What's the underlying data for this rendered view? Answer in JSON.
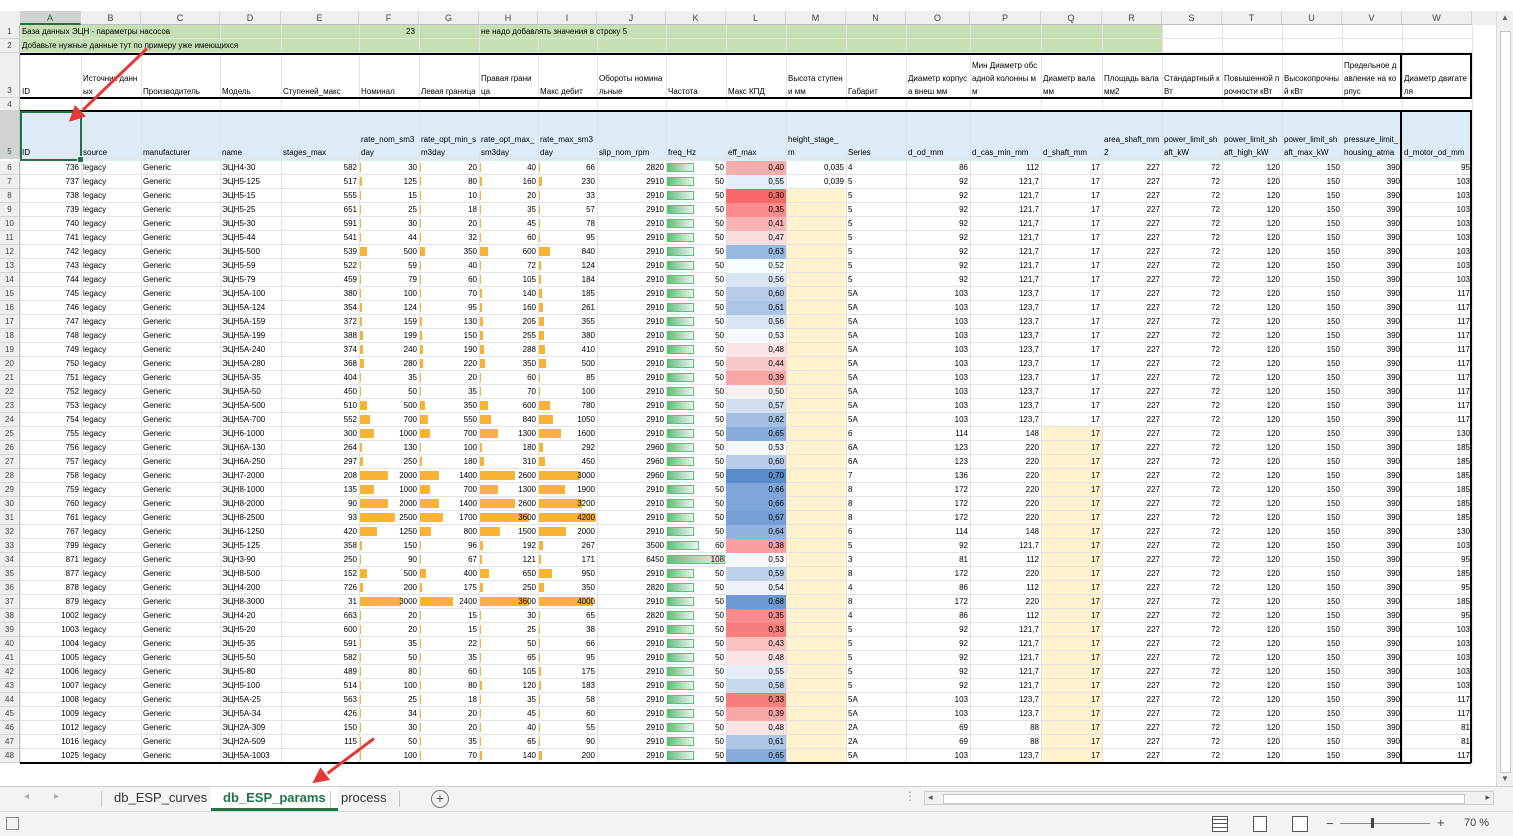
{
  "columns": [
    "A",
    "B",
    "C",
    "D",
    "E",
    "F",
    "G",
    "H",
    "I",
    "J",
    "K",
    "L",
    "M",
    "N",
    "O",
    "P",
    "Q",
    "R",
    "S",
    "T",
    "U",
    "V",
    "W"
  ],
  "row1": {
    "title": "База данных ЭЦН - параметры насосов",
    "value": "23",
    "note": "не надо добавлять значения в строку 5"
  },
  "row2": {
    "hint": "Добавьте нужные данные тут по примеру уже имеющихся"
  },
  "header_ru": [
    "ID",
    "Источник данных",
    "Производитель",
    "Модель",
    "Ступеней_макс",
    "Номинал",
    "Левая граница",
    "Правая граница",
    "Макс дебит",
    "Обороты номинальные",
    "Частота",
    "Макс КПД",
    "Высота ступени мм",
    "Габарит",
    "Диаметр корпуса внеш мм",
    "Мин Диаметр обсадной колонны мм",
    "Диаметр вала мм",
    "Площадь вала мм2",
    "Стандартный кВт",
    "Повышенной прочности кВт",
    "Высокопрочный кВт",
    "Предельное давление на корпус",
    "Диаметр двигателя"
  ],
  "header_en": [
    "ID",
    "source",
    "manufacturer",
    "name",
    "stages_max",
    "rate_nom_sm3day",
    "rate_opt_min_sm3day",
    "rate_opt_max_sm3day",
    "rate_max_sm3day",
    "slip_nom_rpm",
    "freq_Hz",
    "eff_max",
    "height_stage_m",
    "Series",
    "d_od_mm",
    "d_cas_min_mm",
    "d_shaft_mm",
    "area_shaft_mm2",
    "power_limit_shaft_kW",
    "power_limit_shaft_high_kW",
    "power_limit_shaft_max_kW",
    "pressure_limit_housing_atma",
    "d_motor_od_mm"
  ],
  "rows": [
    [
      "736",
      "legacy",
      "Generic",
      "ЭЦН4-30",
      "582",
      "30",
      "20",
      "40",
      "66",
      "2820",
      "50",
      "0,40",
      "0,035",
      "4",
      "86",
      "112",
      "17",
      "227",
      "72",
      "120",
      "150",
      "390",
      "95"
    ],
    [
      "737",
      "legacy",
      "Generic",
      "ЭЦН5-125",
      "517",
      "125",
      "80",
      "160",
      "230",
      "2910",
      "50",
      "0,55",
      "0,039",
      "5",
      "92",
      "121,7",
      "17",
      "227",
      "72",
      "120",
      "150",
      "390",
      "103"
    ],
    [
      "738",
      "legacy",
      "Generic",
      "ЭЦН5-15",
      "555",
      "15",
      "10",
      "20",
      "33",
      "2910",
      "50",
      "0,30",
      "",
      "5",
      "92",
      "121,7",
      "17",
      "227",
      "72",
      "120",
      "150",
      "390",
      "103"
    ],
    [
      "739",
      "legacy",
      "Generic",
      "ЭЦН5-25",
      "651",
      "25",
      "18",
      "35",
      "57",
      "2910",
      "50",
      "0,35",
      "",
      "5",
      "92",
      "121,7",
      "17",
      "227",
      "72",
      "120",
      "150",
      "390",
      "103"
    ],
    [
      "740",
      "legacy",
      "Generic",
      "ЭЦН5-30",
      "591",
      "30",
      "20",
      "45",
      "78",
      "2910",
      "50",
      "0,41",
      "",
      "5",
      "92",
      "121,7",
      "17",
      "227",
      "72",
      "120",
      "150",
      "390",
      "103"
    ],
    [
      "741",
      "legacy",
      "Generic",
      "ЭЦН5-44",
      "541",
      "44",
      "32",
      "60",
      "95",
      "2910",
      "50",
      "0,47",
      "",
      "5",
      "92",
      "121,7",
      "17",
      "227",
      "72",
      "120",
      "150",
      "390",
      "103"
    ],
    [
      "742",
      "legacy",
      "Generic",
      "ЭЦН5-500",
      "539",
      "500",
      "350",
      "600",
      "840",
      "2910",
      "50",
      "0,63",
      "",
      "5",
      "92",
      "121,7",
      "17",
      "227",
      "72",
      "120",
      "150",
      "390",
      "103"
    ],
    [
      "743",
      "legacy",
      "Generic",
      "ЭЦН5-59",
      "522",
      "59",
      "40",
      "72",
      "124",
      "2910",
      "50",
      "0,52",
      "",
      "5",
      "92",
      "121,7",
      "17",
      "227",
      "72",
      "120",
      "150",
      "390",
      "103"
    ],
    [
      "744",
      "legacy",
      "Generic",
      "ЭЦН5-79",
      "459",
      "79",
      "60",
      "105",
      "184",
      "2910",
      "50",
      "0,56",
      "",
      "5",
      "92",
      "121,7",
      "17",
      "227",
      "72",
      "120",
      "150",
      "390",
      "103"
    ],
    [
      "745",
      "legacy",
      "Generic",
      "ЭЦН5А-100",
      "380",
      "100",
      "70",
      "140",
      "185",
      "2910",
      "50",
      "0,60",
      "",
      "5A",
      "103",
      "123,7",
      "17",
      "227",
      "72",
      "120",
      "150",
      "390",
      "117"
    ],
    [
      "746",
      "legacy",
      "Generic",
      "ЭЦН5А-124",
      "354",
      "124",
      "95",
      "160",
      "261",
      "2910",
      "50",
      "0,61",
      "",
      "5A",
      "103",
      "123,7",
      "17",
      "227",
      "72",
      "120",
      "150",
      "390",
      "117"
    ],
    [
      "747",
      "legacy",
      "Generic",
      "ЭЦН5А-159",
      "372",
      "159",
      "130",
      "205",
      "355",
      "2910",
      "50",
      "0,56",
      "",
      "5A",
      "103",
      "123,7",
      "17",
      "227",
      "72",
      "120",
      "150",
      "390",
      "117"
    ],
    [
      "748",
      "legacy",
      "Generic",
      "ЭЦН5А-199",
      "388",
      "199",
      "150",
      "255",
      "380",
      "2910",
      "50",
      "0,53",
      "",
      "5A",
      "103",
      "123,7",
      "17",
      "227",
      "72",
      "120",
      "150",
      "390",
      "117"
    ],
    [
      "749",
      "legacy",
      "Generic",
      "ЭЦН5А-240",
      "374",
      "240",
      "190",
      "288",
      "410",
      "2910",
      "50",
      "0,48",
      "",
      "5A",
      "103",
      "123,7",
      "17",
      "227",
      "72",
      "120",
      "150",
      "390",
      "117"
    ],
    [
      "750",
      "legacy",
      "Generic",
      "ЭЦН5А-280",
      "368",
      "280",
      "220",
      "350",
      "500",
      "2910",
      "50",
      "0,44",
      "",
      "5A",
      "103",
      "123,7",
      "17",
      "227",
      "72",
      "120",
      "150",
      "390",
      "117"
    ],
    [
      "751",
      "legacy",
      "Generic",
      "ЭЦН5А-35",
      "404",
      "35",
      "20",
      "60",
      "85",
      "2910",
      "50",
      "0,39",
      "",
      "5A",
      "103",
      "123,7",
      "17",
      "227",
      "72",
      "120",
      "150",
      "390",
      "117"
    ],
    [
      "752",
      "legacy",
      "Generic",
      "ЭЦН5А-50",
      "450",
      "50",
      "35",
      "70",
      "100",
      "2910",
      "50",
      "0,50",
      "",
      "5A",
      "103",
      "123,7",
      "17",
      "227",
      "72",
      "120",
      "150",
      "390",
      "117"
    ],
    [
      "753",
      "legacy",
      "Generic",
      "ЭЦН5А-500",
      "510",
      "500",
      "350",
      "600",
      "780",
      "2910",
      "50",
      "0,57",
      "",
      "5A",
      "103",
      "123,7",
      "17",
      "227",
      "72",
      "120",
      "150",
      "390",
      "117"
    ],
    [
      "754",
      "legacy",
      "Generic",
      "ЭЦН5А-700",
      "552",
      "700",
      "550",
      "840",
      "1050",
      "2910",
      "50",
      "0,62",
      "",
      "5A",
      "103",
      "123,7",
      "17",
      "227",
      "72",
      "120",
      "150",
      "390",
      "117"
    ],
    [
      "755",
      "legacy",
      "Generic",
      "ЭЦН6-1000",
      "300",
      "1000",
      "700",
      "1300",
      "1600",
      "2910",
      "50",
      "0,65",
      "",
      "6",
      "114",
      "148",
      "17",
      "227",
      "72",
      "120",
      "150",
      "390",
      "130"
    ],
    [
      "756",
      "legacy",
      "Generic",
      "ЭЦН6А-130",
      "264",
      "130",
      "100",
      "180",
      "292",
      "2960",
      "50",
      "0,53",
      "",
      "6A",
      "123",
      "220",
      "17",
      "227",
      "72",
      "120",
      "150",
      "390",
      "185"
    ],
    [
      "757",
      "legacy",
      "Generic",
      "ЭЦН6А-250",
      "297",
      "250",
      "180",
      "310",
      "450",
      "2960",
      "50",
      "0,60",
      "",
      "6A",
      "123",
      "220",
      "17",
      "227",
      "72",
      "120",
      "150",
      "390",
      "185"
    ],
    [
      "758",
      "legacy",
      "Generic",
      "ЭЦН7-2000",
      "208",
      "2000",
      "1400",
      "2600",
      "3000",
      "2960",
      "50",
      "0,70",
      "",
      "7",
      "136",
      "220",
      "17",
      "227",
      "72",
      "120",
      "150",
      "390",
      "185"
    ],
    [
      "759",
      "legacy",
      "Generic",
      "ЭЦН8-1000",
      "135",
      "1000",
      "700",
      "1300",
      "1900",
      "2910",
      "50",
      "0,66",
      "",
      "8",
      "172",
      "220",
      "17",
      "227",
      "72",
      "120",
      "150",
      "390",
      "185"
    ],
    [
      "760",
      "legacy",
      "Generic",
      "ЭЦН8-2000",
      "90",
      "2000",
      "1400",
      "2600",
      "3200",
      "2910",
      "50",
      "0,66",
      "",
      "8",
      "172",
      "220",
      "17",
      "227",
      "72",
      "120",
      "150",
      "390",
      "185"
    ],
    [
      "761",
      "legacy",
      "Generic",
      "ЭЦН8-2500",
      "93",
      "2500",
      "1700",
      "3600",
      "4200",
      "2910",
      "50",
      "0,67",
      "",
      "8",
      "172",
      "220",
      "17",
      "227",
      "72",
      "120",
      "150",
      "390",
      "185"
    ],
    [
      "767",
      "legacy",
      "Generic",
      "ЭЦН6-1250",
      "420",
      "1250",
      "800",
      "1500",
      "2000",
      "2910",
      "50",
      "0,64",
      "",
      "6",
      "114",
      "148",
      "17",
      "227",
      "72",
      "120",
      "150",
      "390",
      "130"
    ],
    [
      "799",
      "legacy",
      "Generic",
      "ЭЦН5-125",
      "358",
      "150",
      "96",
      "192",
      "267",
      "3500",
      "60",
      "0,38",
      "",
      "5",
      "92",
      "121,7",
      "17",
      "227",
      "72",
      "120",
      "150",
      "390",
      "103"
    ],
    [
      "871",
      "legacy",
      "Generic",
      "ЭЦН3-90",
      "250",
      "90",
      "67",
      "121",
      "171",
      "6450",
      "108",
      "0,53",
      "",
      "3",
      "81",
      "112",
      "17",
      "227",
      "72",
      "120",
      "150",
      "390",
      "95"
    ],
    [
      "877",
      "legacy",
      "Generic",
      "ЭЦН8-500",
      "152",
      "500",
      "400",
      "650",
      "950",
      "2910",
      "50",
      "0,59",
      "",
      "8",
      "172",
      "220",
      "17",
      "227",
      "72",
      "120",
      "150",
      "390",
      "185"
    ],
    [
      "878",
      "legacy",
      "Generic",
      "ЭЦН4-200",
      "726",
      "200",
      "175",
      "250",
      "350",
      "2820",
      "50",
      "0,54",
      "",
      "4",
      "86",
      "112",
      "17",
      "227",
      "72",
      "120",
      "150",
      "390",
      "95"
    ],
    [
      "879",
      "legacy",
      "Generic",
      "ЭЦН8-3000",
      "31",
      "3000",
      "2400",
      "3600",
      "4000",
      "2910",
      "50",
      "0,68",
      "",
      "8",
      "172",
      "220",
      "17",
      "227",
      "72",
      "120",
      "150",
      "390",
      "185"
    ],
    [
      "1002",
      "legacy",
      "Generic",
      "ЭЦН4-20",
      "663",
      "20",
      "15",
      "30",
      "65",
      "2820",
      "50",
      "0,35",
      "",
      "4",
      "86",
      "112",
      "17",
      "227",
      "72",
      "120",
      "150",
      "390",
      "95"
    ],
    [
      "1003",
      "legacy",
      "Generic",
      "ЭЦН5-20",
      "600",
      "20",
      "15",
      "25",
      "38",
      "2910",
      "50",
      "0,33",
      "",
      "5",
      "92",
      "121,7",
      "17",
      "227",
      "72",
      "120",
      "150",
      "390",
      "103"
    ],
    [
      "1004",
      "legacy",
      "Generic",
      "ЭЦН5-35",
      "591",
      "35",
      "22",
      "50",
      "66",
      "2910",
      "50",
      "0,43",
      "",
      "5",
      "92",
      "121,7",
      "17",
      "227",
      "72",
      "120",
      "150",
      "390",
      "103"
    ],
    [
      "1005",
      "legacy",
      "Generic",
      "ЭЦН5-50",
      "582",
      "50",
      "35",
      "65",
      "95",
      "2910",
      "50",
      "0,48",
      "",
      "5",
      "92",
      "121,7",
      "17",
      "227",
      "72",
      "120",
      "150",
      "390",
      "103"
    ],
    [
      "1006",
      "legacy",
      "Generic",
      "ЭЦН5-80",
      "489",
      "80",
      "60",
      "105",
      "175",
      "2910",
      "50",
      "0,55",
      "",
      "5",
      "92",
      "121,7",
      "17",
      "227",
      "72",
      "120",
      "150",
      "390",
      "103"
    ],
    [
      "1007",
      "legacy",
      "Generic",
      "ЭЦН5-100",
      "514",
      "100",
      "80",
      "120",
      "183",
      "2910",
      "50",
      "0,58",
      "",
      "5",
      "92",
      "121,7",
      "17",
      "227",
      "72",
      "120",
      "150",
      "390",
      "103"
    ],
    [
      "1008",
      "legacy",
      "Generic",
      "ЭЦН5А-25",
      "563",
      "25",
      "18",
      "35",
      "58",
      "2910",
      "50",
      "0,33",
      "",
      "5A",
      "103",
      "123,7",
      "17",
      "227",
      "72",
      "120",
      "150",
      "390",
      "117"
    ],
    [
      "1009",
      "legacy",
      "Generic",
      "ЭЦН5А-34",
      "426",
      "34",
      "20",
      "45",
      "60",
      "2910",
      "50",
      "0,39",
      "",
      "5A",
      "103",
      "123,7",
      "17",
      "227",
      "72",
      "120",
      "150",
      "390",
      "117"
    ],
    [
      "1012",
      "legacy",
      "Generic",
      "ЭЦН2А-309",
      "150",
      "30",
      "20",
      "40",
      "55",
      "2910",
      "50",
      "0,48",
      "",
      "2A",
      "69",
      "88",
      "17",
      "227",
      "72",
      "120",
      "150",
      "390",
      "81"
    ],
    [
      "1016",
      "legacy",
      "Generic",
      "ЭЦН2А-509",
      "115",
      "50",
      "35",
      "65",
      "90",
      "2910",
      "50",
      "0,61",
      "",
      "2A",
      "69",
      "88",
      "17",
      "227",
      "72",
      "120",
      "150",
      "390",
      "81"
    ],
    [
      "1025",
      "legacy",
      "Generic",
      "ЭЦН5А-1003",
      "",
      "100",
      "70",
      "140",
      "200",
      "2910",
      "50",
      "0,65",
      "",
      "5A",
      "103",
      "123,7",
      "17",
      "227",
      "72",
      "120",
      "150",
      "390",
      "117"
    ]
  ],
  "tabs": [
    "db_ESP_curves",
    "db_ESP_params",
    "process"
  ],
  "zoom": "70 %",
  "colors": {
    "excel_green": "#217346",
    "bar_orange": "#f8b334",
    "header_blue": "#ddebf7",
    "row1_green": "#c6e0b4",
    "highlight_yellow": "#fff2cc",
    "arrow_red": "#e53935"
  }
}
